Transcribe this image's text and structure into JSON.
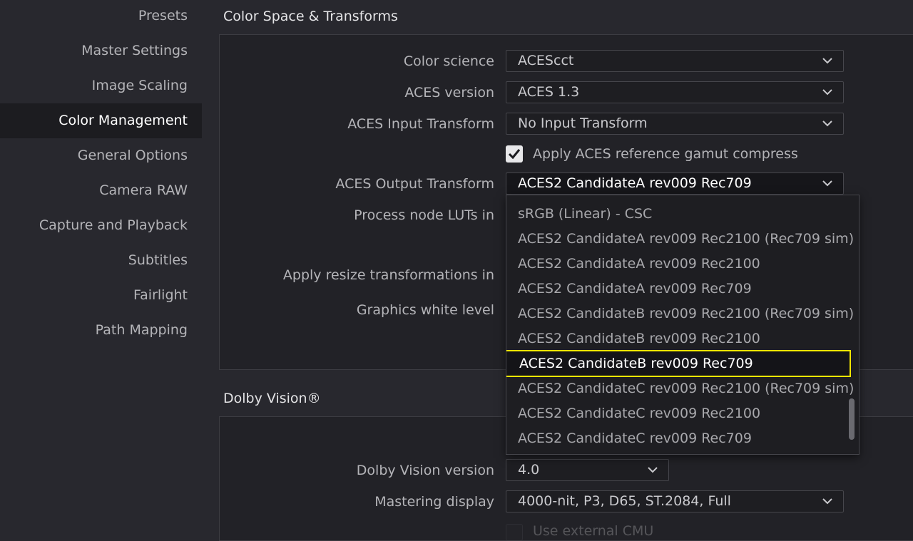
{
  "sidebar": {
    "items": [
      {
        "label": "Presets",
        "active": false
      },
      {
        "label": "Master Settings",
        "active": false
      },
      {
        "label": "Image Scaling",
        "active": false
      },
      {
        "label": "Color Management",
        "active": true
      },
      {
        "label": "General Options",
        "active": false
      },
      {
        "label": "Camera RAW",
        "active": false
      },
      {
        "label": "Capture and Playback",
        "active": false
      },
      {
        "label": "Subtitles",
        "active": false
      },
      {
        "label": "Fairlight",
        "active": false
      },
      {
        "label": "Path Mapping",
        "active": false
      }
    ]
  },
  "color_space": {
    "title": "Color Space & Transforms",
    "color_science": {
      "label": "Color science",
      "value": "ACEScct"
    },
    "aces_version": {
      "label": "ACES version",
      "value": "ACES 1.3"
    },
    "input_transform": {
      "label": "ACES Input Transform",
      "value": "No Input Transform"
    },
    "gamut_compress": {
      "label": "Apply ACES reference gamut compress",
      "checked": true
    },
    "output_transform": {
      "label": "ACES Output Transform",
      "value": "ACES2 CandidateA rev009 Rec709"
    },
    "process_node_luts": {
      "label": "Process node LUTs in"
    },
    "resize_transforms": {
      "label": "Apply resize transformations in"
    },
    "graphics_white": {
      "label": "Graphics white level"
    }
  },
  "output_menu": {
    "options": [
      "sRGB (Linear) - CSC",
      "ACES2 CandidateA rev009 Rec2100 (Rec709 sim)",
      "ACES2 CandidateA rev009 Rec2100",
      "ACES2 CandidateA rev009 Rec709",
      "ACES2 CandidateB rev009 Rec2100 (Rec709 sim)",
      "ACES2 CandidateB rev009 Rec2100",
      "ACES2 CandidateB rev009 Rec709",
      "ACES2 CandidateC rev009 Rec2100 (Rec709 sim)",
      "ACES2 CandidateC rev009 Rec2100",
      "ACES2 CandidateC rev009 Rec709"
    ],
    "highlighted": "ACES2 CandidateB rev009 Rec709",
    "highlight_color": "#f2e600"
  },
  "dolby": {
    "title": "Dolby Vision®",
    "version": {
      "label": "Dolby Vision version",
      "value": "4.0"
    },
    "mastering_display": {
      "label": "Mastering display",
      "value": "4000-nit, P3, D65, ST.2084, Full"
    },
    "external_cmu": {
      "label": "Use external CMU",
      "checked": false
    }
  }
}
